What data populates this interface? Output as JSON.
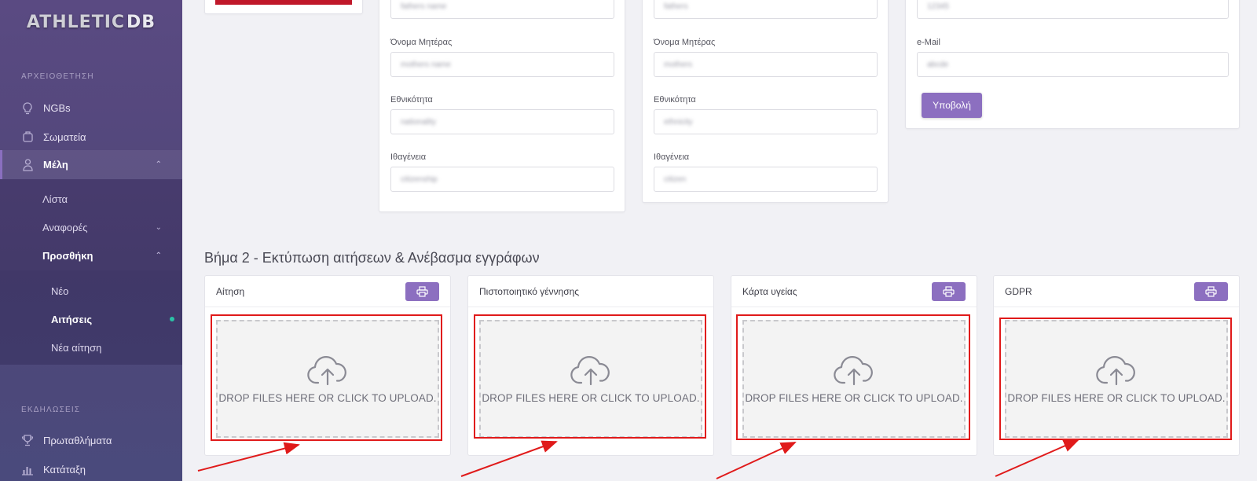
{
  "app": {
    "logo_main": "ATHLETIC",
    "logo_suffix": "DB"
  },
  "sidebar": {
    "section1": "ΑΡΧΕΙΟΘΕΤΗΣΗ",
    "items": [
      {
        "label": "NGBs",
        "icon": "lightbulb-icon"
      },
      {
        "label": "Σωματεία",
        "icon": "club-icon"
      },
      {
        "label": "Μέλη",
        "icon": "member-icon",
        "chevron": "^"
      }
    ],
    "sub": [
      {
        "label": "Λίστα"
      },
      {
        "label": "Αναφορές",
        "chevron": "v"
      },
      {
        "label": "Προσθήκη",
        "chevron": "^"
      }
    ],
    "subsub": [
      {
        "label": "Νέο"
      },
      {
        "label": "Αιτήσεις"
      },
      {
        "label": "Νέα αίτηση"
      }
    ],
    "section2": "ΕΚΔΗΛΩΣΕΙΣ",
    "items2": [
      {
        "label": "Πρωταθλήματα",
        "icon": "trophy-icon"
      },
      {
        "label": "Κατάταξη",
        "icon": "bar-chart-icon"
      }
    ]
  },
  "form": {
    "col1": {
      "top_value": "fathers name",
      "fields": [
        {
          "label": "Όνομα Μητέρας",
          "value": "mothers name"
        },
        {
          "label": "Εθνικότητα",
          "value": "nationality"
        },
        {
          "label": "Ιθαγένεια",
          "value": "citizenship"
        }
      ]
    },
    "col2": {
      "top_value": "fathers",
      "fields": [
        {
          "label": "Όνομα Μητέρας",
          "value": "mothers"
        },
        {
          "label": "Εθνικότητα",
          "value": "ethnicity"
        },
        {
          "label": "Ιθαγένεια",
          "value": "citizen"
        }
      ]
    },
    "col3": {
      "top_value": "12345",
      "email_label": "e-Mail",
      "email_value": "abcde",
      "submit_label": "Υποβολή"
    }
  },
  "step2": {
    "title": "Βήμα 2 - Εκτύπωση αιτήσεων & Ανέβασμα εγγράφων",
    "drop_text": "DROP FILES HERE OR CLICK TO UPLOAD.",
    "cards": [
      {
        "title": "Αίτηση",
        "has_print": true
      },
      {
        "title": "Πιστοποιητικό γέννησης",
        "has_print": false
      },
      {
        "title": "Κάρτα υγείας",
        "has_print": true
      },
      {
        "title": "GDPR",
        "has_print": true
      }
    ]
  },
  "colors": {
    "accent": "#8c6fc0",
    "annotation": "#e01a1a",
    "sidebar": "#544878",
    "active_dot": "#2bc2a6"
  }
}
